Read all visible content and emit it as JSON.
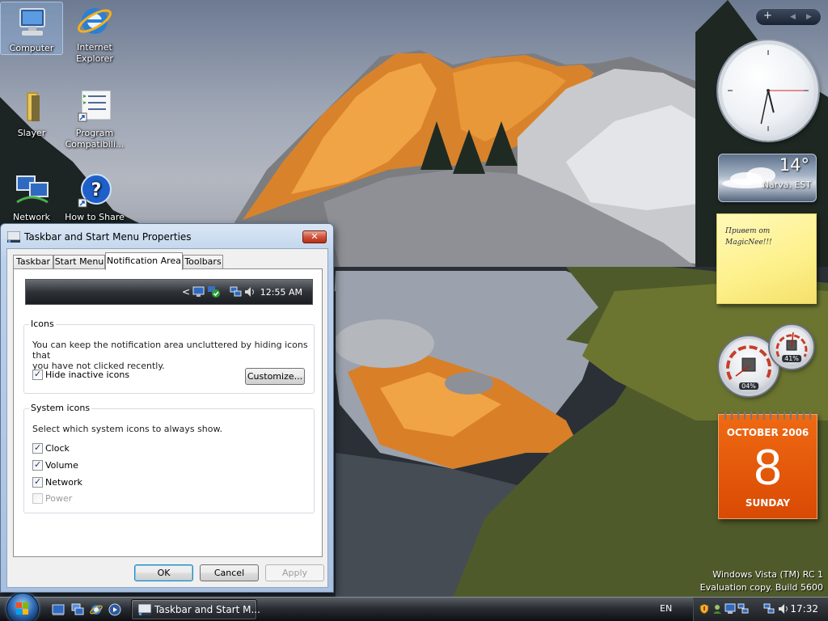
{
  "desktop": {
    "icons": [
      {
        "label": "Computer",
        "icon": "computer-icon"
      },
      {
        "label": "Internet Explorer",
        "icon": "internet-explorer-icon"
      },
      {
        "label": "Slayer",
        "icon": "folder-icon"
      },
      {
        "label": "Program Compatibili...",
        "icon": "program-compatibility-icon"
      },
      {
        "label": "Network",
        "icon": "network-icon"
      },
      {
        "label": "How to Share",
        "icon": "help-icon"
      }
    ],
    "watermark": {
      "line1": "Windows Vista (TM) RC 1",
      "line2": "Evaluation copy. Build 5600"
    }
  },
  "gadgets": {
    "controls": {
      "add": "+",
      "prev": "◀",
      "next": "▶"
    },
    "clock": {
      "hour": 5,
      "minute": 32,
      "second": 15
    },
    "weather": {
      "temperature": "14°",
      "location": "Narva, EST"
    },
    "note": {
      "line1": "Привет от",
      "line2": "MagicNee!!!"
    },
    "meters": {
      "cpu_percent": "04%",
      "memory_percent": "41%"
    },
    "calendar": {
      "month_year": "OCTOBER 2006",
      "day": "8",
      "weekday": "SUNDAY"
    }
  },
  "dialog": {
    "title": "Taskbar and Start Menu Properties",
    "close_label": "✕",
    "tabs": [
      {
        "label": "Taskbar",
        "active": false
      },
      {
        "label": "Start Menu",
        "active": false
      },
      {
        "label": "Notification Area",
        "active": true
      },
      {
        "label": "Toolbars",
        "active": false
      }
    ],
    "preview": {
      "time": "12:55 AM",
      "expand": "<"
    },
    "icons_group": {
      "legend": "Icons",
      "description_line1": "You can keep the notification area uncluttered by hiding icons that",
      "description_line2": "you have not clicked recently.",
      "hide_inactive": {
        "label": "Hide inactive icons",
        "checked": true
      },
      "customize_label": "Customize..."
    },
    "system_icons_group": {
      "legend": "System icons",
      "description": "Select which system icons to always show.",
      "items": [
        {
          "label": "Clock",
          "checked": true,
          "enabled": true
        },
        {
          "label": "Volume",
          "checked": true,
          "enabled": true
        },
        {
          "label": "Network",
          "checked": true,
          "enabled": true
        },
        {
          "label": "Power",
          "checked": false,
          "enabled": false
        }
      ]
    },
    "buttons": {
      "ok": "OK",
      "cancel": "Cancel",
      "apply": "Apply"
    }
  },
  "taskbar": {
    "quick_launch": [
      "show-desktop-icon",
      "switch-windows-icon",
      "internet-explorer-icon",
      "media-player-icon"
    ],
    "task_button": "Taskbar and Start M...",
    "language": "EN",
    "clock": "17:32"
  }
}
